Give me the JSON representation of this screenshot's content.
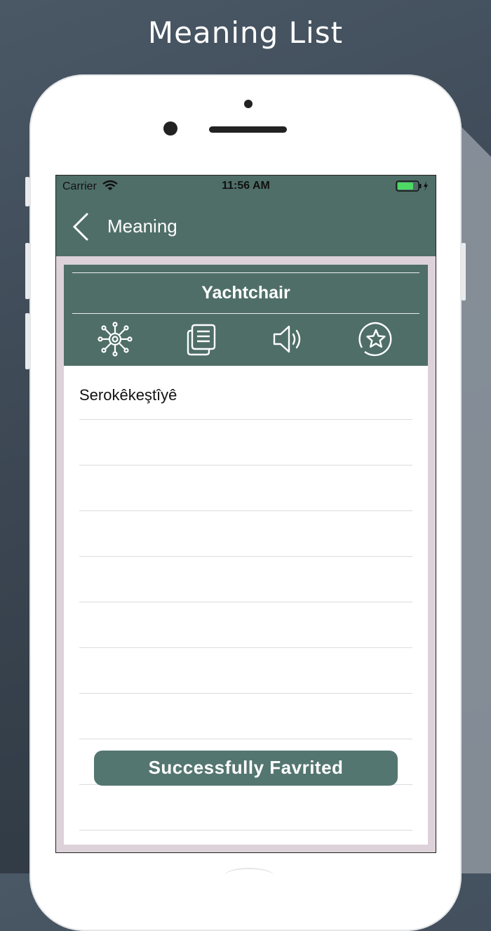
{
  "headline": "Meaning List",
  "status_bar": {
    "carrier": "Carrier",
    "time": "11:56 AM"
  },
  "nav": {
    "title": "Meaning",
    "back_icon": "chevron-left-icon"
  },
  "word_card": {
    "word": "Yachtchair",
    "actions": [
      {
        "name": "network-icon"
      },
      {
        "name": "copy-icon"
      },
      {
        "name": "speaker-icon"
      },
      {
        "name": "star-icon"
      }
    ]
  },
  "meanings": [
    "Serokêkeştîyê"
  ],
  "toast": {
    "message": "Successfully Favrited"
  },
  "colors": {
    "primary": "#4f6e68",
    "toast": "#547670",
    "frame": "#ddd2d9"
  }
}
